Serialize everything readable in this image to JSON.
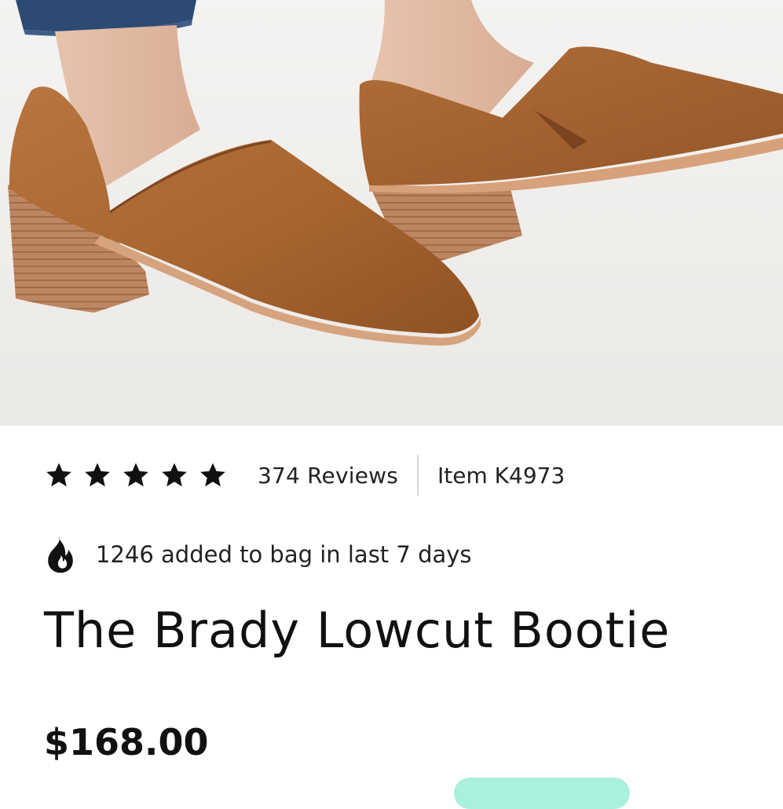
{
  "product": {
    "name": "The Brady Lowcut Bootie",
    "price": "$168.00",
    "rating": 5,
    "rating_max": 5,
    "reviews_label": "374 Reviews",
    "item_label": "Item K4973",
    "popularity_text": "1246 added to bag in last 7 days"
  },
  "icons": {
    "rating": "star-icon",
    "popularity": "fire-icon"
  },
  "colors": {
    "cta_accent": "#a9f0dd",
    "text": "#111111",
    "divider": "#d6d6d6"
  }
}
